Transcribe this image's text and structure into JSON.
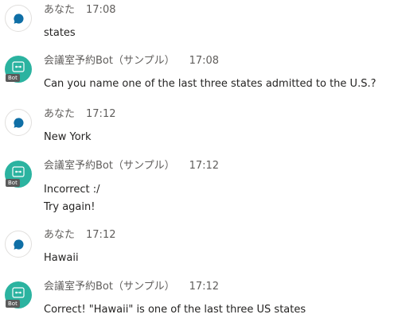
{
  "messages": [
    {
      "sender": "あなた",
      "time": "17:08",
      "lines": [
        "states"
      ],
      "is_bot": false
    },
    {
      "sender": "会議室予約Bot（サンプル）",
      "time": "17:08",
      "lines": [
        "Can you name one of the last three states admitted to the U.S.?"
      ],
      "is_bot": true
    },
    {
      "sender": "あなた",
      "time": "17:12",
      "lines": [
        "New York"
      ],
      "is_bot": false
    },
    {
      "sender": "会議室予約Bot（サンプル）",
      "time": "17:12",
      "lines": [
        "Incorrect :/",
        "Try again!"
      ],
      "is_bot": true
    },
    {
      "sender": "あなた",
      "time": "17:12",
      "lines": [
        "Hawaii"
      ],
      "is_bot": false
    },
    {
      "sender": "会議室予約Bot（サンプル）",
      "time": "17:12",
      "lines": [
        "Correct! \"Hawaii\" is one of the last three US states"
      ],
      "is_bot": true
    }
  ],
  "bot_badge": "Bot",
  "icons": {
    "user_avatar": "chat-bubble-icon",
    "bot_avatar": "bot-face-icon"
  },
  "colors": {
    "user_bubble": "#0f6fa6",
    "bot_avatar_bg": "#2bb3a0",
    "meta_text": "#605e5c",
    "body_text": "#252423"
  }
}
